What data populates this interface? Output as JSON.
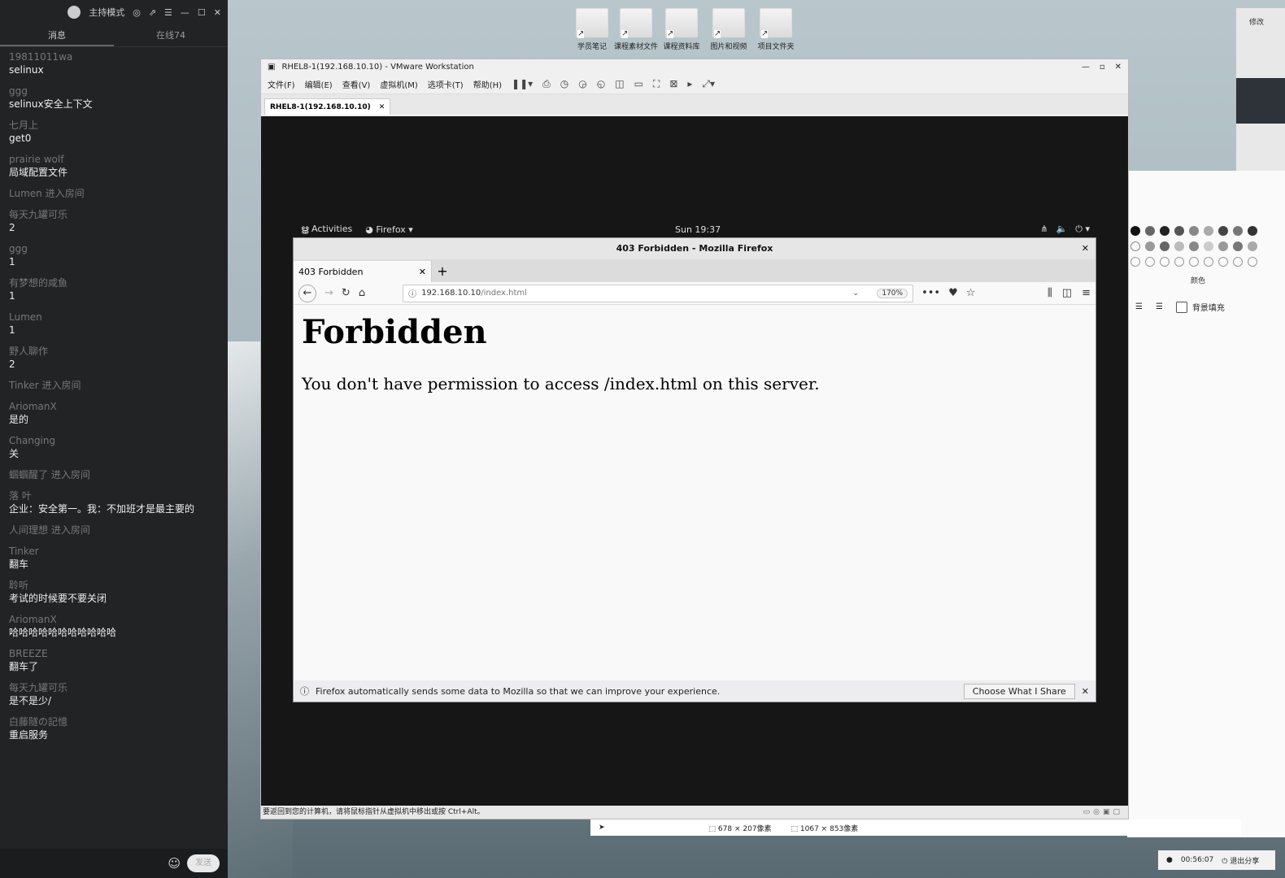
{
  "chat": {
    "mode_label": "主持模式",
    "tabs": [
      "消息",
      "在线74"
    ],
    "messages": [
      {
        "user": "19811011wa",
        "text": "selinux"
      },
      {
        "user": "ggg",
        "text": "selinux安全上下文"
      },
      {
        "user": "七月上",
        "text": "get0"
      },
      {
        "user": "prairie wolf",
        "text": "局域配置文件"
      },
      {
        "user": "Lumen 进入房间",
        "text": ""
      },
      {
        "user": "每天九罐可乐",
        "text": "2"
      },
      {
        "user": "ggg",
        "text": "1"
      },
      {
        "user": "有梦想的咸鱼",
        "text": "1"
      },
      {
        "user": "Lumen",
        "text": "1"
      },
      {
        "user": "野人聊作",
        "text": "2"
      },
      {
        "user": "Tinker 进入房间",
        "text": ""
      },
      {
        "user": "AriomanX",
        "text": "是的"
      },
      {
        "user": "Changing",
        "text": "关"
      },
      {
        "user": "蝈蝈醒了 进入房间",
        "text": ""
      },
      {
        "user": "落  叶",
        "text": "企业：安全第一。我：不加班才是最主要的"
      },
      {
        "user": "人间理想 进入房间",
        "text": ""
      },
      {
        "user": "Tinker",
        "text": "翻车"
      },
      {
        "user": "聆听",
        "text": "考试的时候要不要关闭"
      },
      {
        "user": "AriomanX",
        "text": "哈哈哈哈哈哈哈哈哈哈哈"
      },
      {
        "user": "BREEZE",
        "text": "翻车了"
      },
      {
        "user": "每天九罐可乐",
        "text": "是不是少/"
      },
      {
        "user": "白藤隧の記憶",
        "text": "重启服务"
      }
    ],
    "send_label": "发送"
  },
  "desktop_icons": [
    "学员笔记",
    "课程素材文件",
    "课程资料库",
    "图片和视频",
    "项目文件夹"
  ],
  "vmware": {
    "title": "RHEL8-1(192.168.10.10) - VMware Workstation",
    "menu": [
      "文件(F)",
      "编辑(E)",
      "查看(V)",
      "虚拟机(M)",
      "选项卡(T)",
      "帮助(H)"
    ],
    "tab": "RHEL8-1(192.168.10.10)",
    "status": "要返回到您的计算机，请将鼠标指针从虚拟机中移出或按 Ctrl+Alt。"
  },
  "gnome": {
    "activities": "Activities",
    "app": "Firefox",
    "clock": "Sun 19:37"
  },
  "firefox": {
    "window_title": "403 Forbidden - Mozilla Firefox",
    "tab_title": "403 Forbidden",
    "url_host": "192.168.10.10",
    "url_path": "/index.html",
    "zoom": "170%",
    "heading": "Forbidden",
    "message": "You don't have permission to access /index.html on this server.",
    "notice": "Firefox automatically sends some data to Mozilla so that we can improve your experience.",
    "notice_button": "Choose What I Share"
  },
  "right_panel": {
    "color_label": "颜色",
    "fill_label": "背景填充",
    "top_label": "修改"
  },
  "recorder": {
    "sel1": "678 × 207像素",
    "sel2": "1067 × 853像素"
  },
  "timer": {
    "time": "00:56:07",
    "exit": "退出分享"
  }
}
